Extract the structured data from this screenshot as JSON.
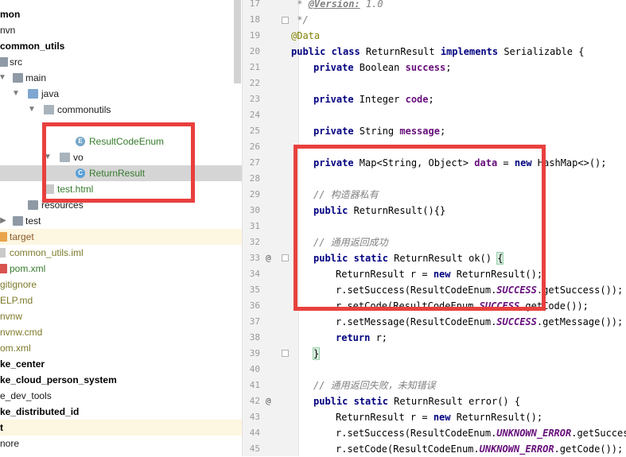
{
  "tree": {
    "items": [
      {
        "label": "mon",
        "style": "bold"
      },
      {
        "label": "nvn",
        "style": "dark"
      },
      {
        "label": "common_utils",
        "style": "bold"
      },
      {
        "label": "src",
        "style": "dark"
      },
      {
        "label": "main",
        "style": "dark"
      },
      {
        "label": "java",
        "style": "dark"
      },
      {
        "label": "commonutils",
        "style": "dark"
      },
      {
        "label": "",
        "style": "dark"
      },
      {
        "label": "ResultCodeEnum",
        "style": "green"
      },
      {
        "label": "vo",
        "style": "dark"
      },
      {
        "label": "ReturnResult",
        "style": "green"
      },
      {
        "label": "test.html",
        "style": "green"
      },
      {
        "label": "resources",
        "style": "dark"
      },
      {
        "label": "test",
        "style": "dark"
      },
      {
        "label": "target",
        "style": "brown"
      },
      {
        "label": "common_utils.iml",
        "style": "olive"
      },
      {
        "label": "pom.xml",
        "style": "green"
      },
      {
        "label": "gitignore",
        "style": "olive"
      },
      {
        "label": "ELP.md",
        "style": "olive"
      },
      {
        "label": "nvnw",
        "style": "olive"
      },
      {
        "label": "nvnw.cmd",
        "style": "olive"
      },
      {
        "label": "om.xml",
        "style": "olive"
      },
      {
        "label": "ke_center",
        "style": "bold"
      },
      {
        "label": "ke_cloud_person_system",
        "style": "bold"
      },
      {
        "label": "e_dev_tools",
        "style": "dark"
      },
      {
        "label": "ke_distributed_id",
        "style": "bold"
      },
      {
        "label": "t",
        "style": "bold"
      },
      {
        "label": "nore",
        "style": "dark"
      },
      {
        "label": "",
        "style": "dark"
      }
    ]
  },
  "editor": {
    "line_numbers": [
      "17",
      "18",
      "19",
      "20",
      "21",
      "22",
      "23",
      "24",
      "25",
      "26",
      "27",
      "28",
      "29",
      "30",
      "31",
      "32",
      "33",
      "34",
      "35",
      "36",
      "37",
      "38",
      "39",
      "40",
      "41",
      "42",
      "43",
      "44",
      "45"
    ],
    "lines": {
      "l17": {
        "a": " * ",
        "b": "@Version:",
        "c": " 1.0"
      },
      "l18": " */",
      "l19": "@Data",
      "l20": {
        "k1": "public class",
        "t": " ReturnResult ",
        "k2": "implements",
        "t2": " Serializable {"
      },
      "l21": {
        "k": "private",
        "t": " Boolean ",
        "f": "success",
        "e": ";"
      },
      "l23": {
        "k": "private",
        "t": " Integer ",
        "f": "code",
        "e": ";"
      },
      "l25": {
        "k": "private",
        "t": " String ",
        "f": "message",
        "e": ";"
      },
      "l27": {
        "k": "private",
        "t": " Map<String, Object> ",
        "f": "data",
        "m": " = ",
        "k2": "new",
        "e": " HashMap<>();"
      },
      "l29": "// 构造器私有",
      "l30": {
        "k": "public",
        "t": " ReturnResult(){}"
      },
      "l32": "// 通用返回成功",
      "l33": {
        "k": "public static",
        "t": " ReturnResult ",
        "n": "ok",
        "e": "() ",
        "b": "{"
      },
      "l34": {
        "t": "ReturnResult r = ",
        "k": "new",
        "e": " ReturnResult();"
      },
      "l35": {
        "t": "r.setSuccess(ResultCodeEnum.",
        "s": "SUCCESS",
        "e": ".getSuccess());"
      },
      "l36": {
        "t": "r.setCode(ResultCodeEnum.",
        "s": "SUCCESS",
        "e": ".getCode());"
      },
      "l37": {
        "t": "r.setMessage(ResultCodeEnum.",
        "s": "SUCCESS",
        "e": ".getMessage());"
      },
      "l38": {
        "k": "return",
        "e": " r;"
      },
      "l39": "}",
      "l41": "// 通用返回失败，未知错误",
      "l42": {
        "k": "public static",
        "t": " ReturnResult ",
        "n": "error",
        "e": "() {"
      },
      "l43": {
        "t": "ReturnResult r = ",
        "k": "new",
        "e": " ReturnResult();"
      },
      "l44": {
        "t": "r.setSuccess(ResultCodeEnum.",
        "s": "UNKNOWN_ERROR",
        "e": ".getSuccess"
      },
      "l45": {
        "t": "r.setCode(ResultCodeEnum.",
        "s": "UNKNOWN_ERROR",
        "e": ".getCode());"
      }
    },
    "gutter_marks": {
      "l33": "@",
      "l42": "@"
    }
  },
  "colors": {
    "annotation_box": "#e8403e",
    "keyword": "#000080",
    "field": "#660e7a",
    "comment": "#808080",
    "annotation": "#808000"
  }
}
